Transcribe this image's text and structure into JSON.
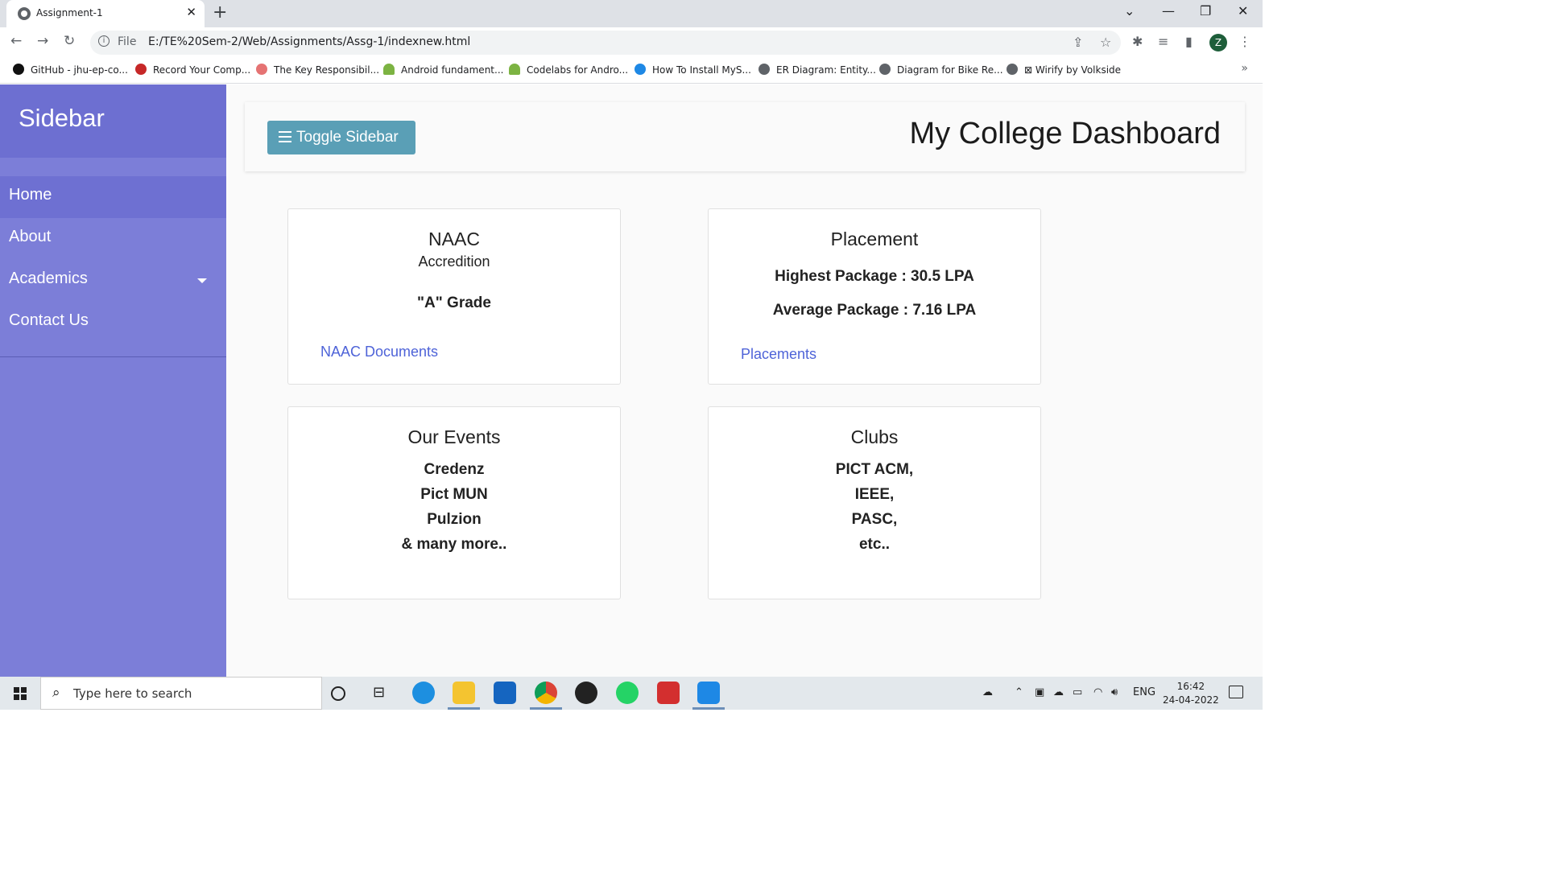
{
  "browser": {
    "tab_title": "Assignment-1",
    "tab_close": "✕",
    "new_tab": "+",
    "url_scheme": "File",
    "url": "E:/TE%20Sem-2/Web/Assignments/Assg-1/indexnew.html",
    "profile_initial": "Z",
    "bookmarks": [
      {
        "label": "GitHub - jhu-ep-co...",
        "color": "#111111"
      },
      {
        "label": "Record Your Comp...",
        "color": "#c62828"
      },
      {
        "label": "The Key Responsibil...",
        "color": "#e57373"
      },
      {
        "label": "Android fundament...",
        "color": "#7cb342"
      },
      {
        "label": "Codelabs for Andro...",
        "color": "#7cb342"
      },
      {
        "label": "How To Install MyS...",
        "color": "#1e88e5"
      },
      {
        "label": "ER Diagram: Entity...",
        "color": "#5f6368"
      },
      {
        "label": "Diagram for Bike Re...",
        "color": "#5f6368"
      },
      {
        "label": "⊠ Wirify by Volkside",
        "color": "#5f6368"
      }
    ]
  },
  "sidebar": {
    "title": "Sidebar",
    "items": [
      {
        "label": "Home"
      },
      {
        "label": "About"
      },
      {
        "label": "Academics"
      },
      {
        "label": "Contact Us"
      }
    ]
  },
  "topbar": {
    "toggle_label": "Toggle Sidebar",
    "title": "My College Dashboard"
  },
  "cards": {
    "naac": {
      "title": "NAAC",
      "subtitle": "Accredition",
      "grade": "\"A\" Grade",
      "link": "NAAC Documents"
    },
    "placement": {
      "title": "Placement",
      "highest": "Highest Package : 30.5 LPA",
      "average": "Average Package : 7.16 LPA",
      "link": "Placements"
    },
    "events": {
      "title": "Our Events",
      "items": [
        "Credenz",
        "Pict MUN",
        "Pulzion",
        "& many more.."
      ]
    },
    "clubs": {
      "title": "Clubs",
      "items": [
        "PICT ACM,",
        "IEEE,",
        "PASC,",
        "etc.."
      ]
    }
  },
  "taskbar": {
    "search_placeholder": "Type here to search",
    "language": "ENG",
    "time": "16:42",
    "date": "24-04-2022"
  },
  "colors": {
    "sidebar_bg": "#7c7ed8",
    "toggle_button": "#5a9fb6",
    "link": "#4e63d8"
  }
}
